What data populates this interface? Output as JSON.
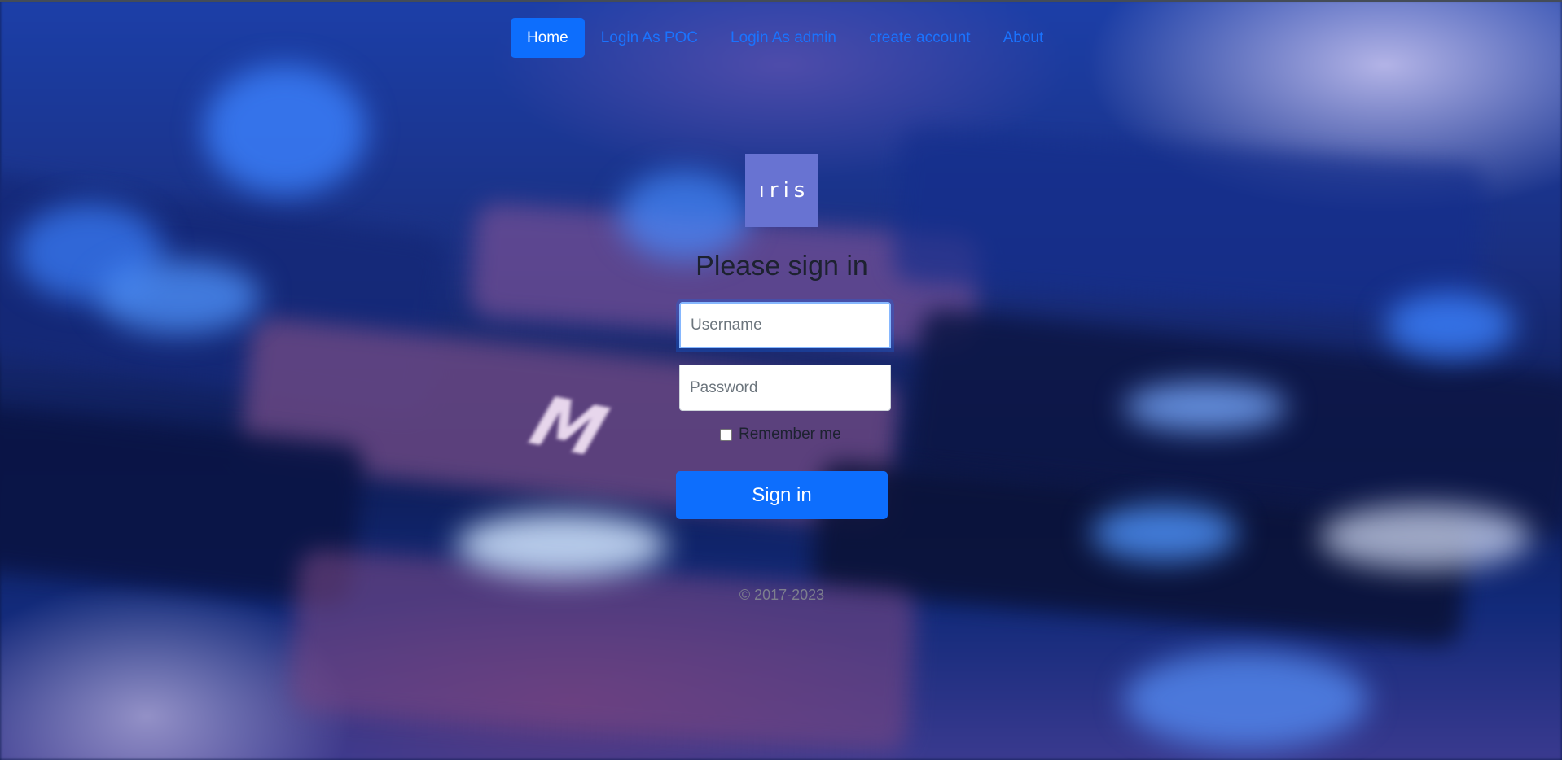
{
  "nav": {
    "items": [
      {
        "label": "Home",
        "active": true
      },
      {
        "label": "Login As POC",
        "active": false
      },
      {
        "label": "Login As admin",
        "active": false
      },
      {
        "label": "create account",
        "active": false
      },
      {
        "label": "About",
        "active": false
      }
    ]
  },
  "logo": {
    "text": "ıris",
    "color": "#6873d2"
  },
  "form": {
    "title": "Please sign in",
    "username_placeholder": "Username",
    "username_value": "",
    "password_placeholder": "Password",
    "password_value": "",
    "remember_label": "Remember me",
    "remember_checked": false,
    "submit_label": "Sign in"
  },
  "footer": {
    "copyright": "© 2017-2023"
  },
  "colors": {
    "primary": "#0d6efd",
    "link": "#1a73ff",
    "title_text": "#1d2230"
  }
}
